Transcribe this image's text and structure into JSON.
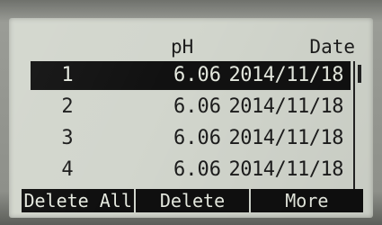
{
  "header": {
    "ph_label": "pH",
    "date_label": "Date"
  },
  "rows": [
    {
      "num": "1",
      "ph": "6.06",
      "date": "2014/11/18",
      "selected": true
    },
    {
      "num": "2",
      "ph": "6.06",
      "date": "2014/11/18",
      "selected": false
    },
    {
      "num": "3",
      "ph": "6.06",
      "date": "2014/11/18",
      "selected": false
    },
    {
      "num": "4",
      "ph": "6.06",
      "date": "2014/11/18",
      "selected": false
    }
  ],
  "softkeys": {
    "delete_all": "Delete All",
    "delete": "Delete",
    "more": "More"
  },
  "colors": {
    "lcd_background": "#d2d6cd",
    "selection": "#111111"
  }
}
